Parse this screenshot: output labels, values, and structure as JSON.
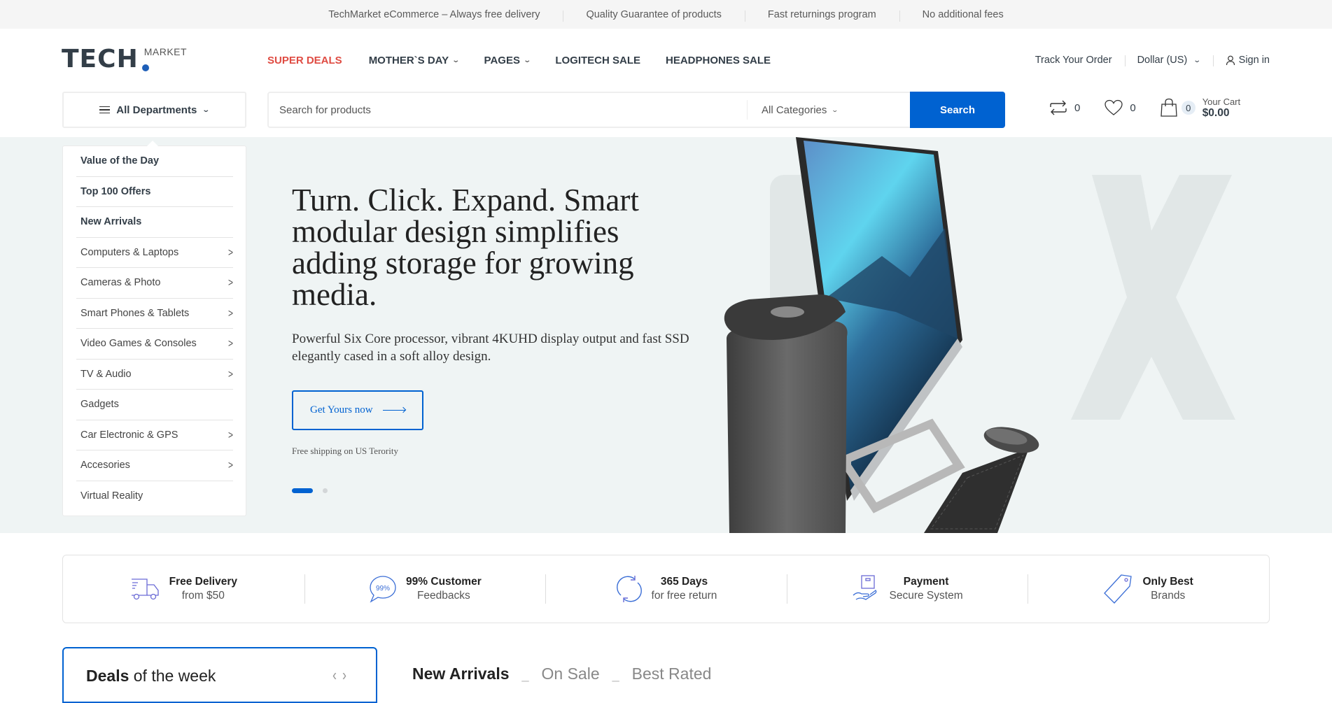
{
  "topbar": {
    "messages": [
      "TechMarket eCommerce – Always free delivery",
      "Quality Guarantee of products",
      "Fast returnings program",
      "No additional fees"
    ]
  },
  "logo": {
    "main": "TECH",
    "sub": "MARKET",
    "accent_color": "#1e5fb8"
  },
  "nav": {
    "items": [
      {
        "label": "SUPER DEALS",
        "highlight": true,
        "dropdown": false
      },
      {
        "label": "MOTHER`S DAY",
        "highlight": false,
        "dropdown": true
      },
      {
        "label": "PAGES",
        "highlight": false,
        "dropdown": true
      },
      {
        "label": "LOGITECH SALE",
        "highlight": false,
        "dropdown": false
      },
      {
        "label": "HEADPHONES SALE",
        "highlight": false,
        "dropdown": false
      }
    ],
    "highlight_color": "#df4b42"
  },
  "header_right": {
    "track_order": "Track Your Order",
    "currency": "Dollar (US)",
    "sign_in": "Sign in"
  },
  "departments": {
    "button_label": "All Departments",
    "items": [
      {
        "label": "Value of the Day",
        "bold": true,
        "submenu": false
      },
      {
        "label": "Top 100 Offers",
        "bold": true,
        "submenu": false
      },
      {
        "label": "New Arrivals",
        "bold": true,
        "submenu": false
      },
      {
        "label": "Computers & Laptops",
        "bold": false,
        "submenu": true
      },
      {
        "label": "Cameras & Photo",
        "bold": false,
        "submenu": true
      },
      {
        "label": "Smart Phones & Tablets",
        "bold": false,
        "submenu": true
      },
      {
        "label": "Video Games & Consoles",
        "bold": false,
        "submenu": true
      },
      {
        "label": "TV & Audio",
        "bold": false,
        "submenu": true
      },
      {
        "label": "Gadgets",
        "bold": false,
        "submenu": false
      },
      {
        "label": "Car Electronic & GPS",
        "bold": false,
        "submenu": true
      },
      {
        "label": "Accesories",
        "bold": false,
        "submenu": true
      },
      {
        "label": "Virtual Reality",
        "bold": false,
        "submenu": false
      }
    ]
  },
  "search": {
    "placeholder": "Search for products",
    "value": "",
    "category": "All Categories",
    "button_label": "Search",
    "button_color": "#0062d1"
  },
  "header_icons": {
    "compare_count": "0",
    "wishlist_count": "0",
    "cart_count": "0",
    "cart_label": "Your Cart",
    "cart_total": "$0.00"
  },
  "hero": {
    "title": "Turn. Click. Expand. Smart modular design simplifies adding storage for growing media.",
    "subtitle": "Powerful Six Core processor, vibrant 4KUHD display output and fast SSD elegantly cased in a soft alloy design.",
    "cta_label": "Get Yours now",
    "note": "Free shipping on US Terority",
    "slides_total": 2,
    "active_slide": 1
  },
  "features": [
    {
      "icon": "delivery-truck-icon",
      "title": "Free Delivery",
      "subtitle": "from $50"
    },
    {
      "icon": "feedback-bubble-icon",
      "title": "99% Customer",
      "subtitle": "Feedbacks",
      "icon_text": "99%"
    },
    {
      "icon": "return-cycle-icon",
      "title": "365 Days",
      "subtitle": "for free return"
    },
    {
      "icon": "secure-payment-icon",
      "title": "Payment",
      "subtitle": "Secure System"
    },
    {
      "icon": "price-tag-icon",
      "title": "Only Best",
      "subtitle": "Brands"
    }
  ],
  "deals": {
    "title_bold": "Deals",
    "title_rest": " of the week"
  },
  "product_tabs": [
    {
      "label": "New Arrivals",
      "active": true
    },
    {
      "label": "On Sale",
      "active": false
    },
    {
      "label": "Best Rated",
      "active": false
    }
  ]
}
